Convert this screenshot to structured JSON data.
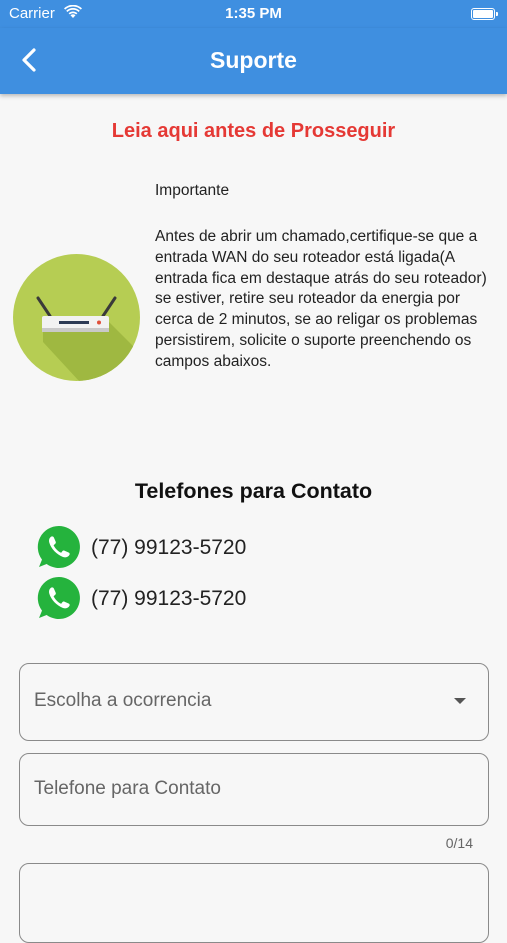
{
  "status_bar": {
    "carrier": "Carrier",
    "time": "1:35 PM"
  },
  "app_bar": {
    "title": "Suporte",
    "back_icon": "chevron-left-icon"
  },
  "notice": {
    "title": "Leia aqui antes de Prosseguir",
    "title_color": "#e53935",
    "heading": "Importante",
    "body": "Antes de abrir um chamado,certifique-se que a entrada WAN do seu roteador está ligada(A entrada fica em destaque atrás do seu roteador) se estiver, retire seu roteador da energia por cerca de 2 minutos, se ao religar os problemas persistirem, solicite o suporte preenchendo os campos abaixos.",
    "image_icon": "router-icon"
  },
  "contacts": {
    "title": "Telefones para Contato",
    "phones": [
      {
        "number": "(77) 99123-5720",
        "icon": "whatsapp-icon"
      },
      {
        "number": "(77) 99123-5720",
        "icon": "whatsapp-icon"
      }
    ]
  },
  "form": {
    "occurrence_label": "Escolha a ocorrencia",
    "phone_label": "Telefone para Contato",
    "phone_counter": "0/14"
  },
  "colors": {
    "app_bar": "#3f8fe0",
    "whatsapp": "#25b33d",
    "router_bg": "#b6cd53"
  }
}
